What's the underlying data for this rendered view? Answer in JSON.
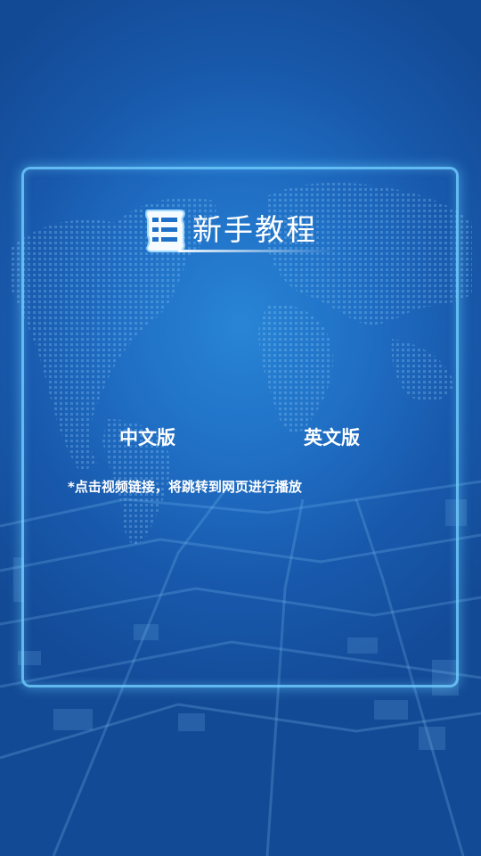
{
  "tutorial": {
    "title": "新手教程",
    "title_icon": "list-scroll-icon",
    "links": {
      "chinese_version": "中文版",
      "english_version": "英文版"
    },
    "note": "*点击视频链接，将跳转到网页进行播放"
  },
  "colors": {
    "background": "#1f6fc4",
    "panel_border": "#6ecdff",
    "text": "#ffffff"
  }
}
